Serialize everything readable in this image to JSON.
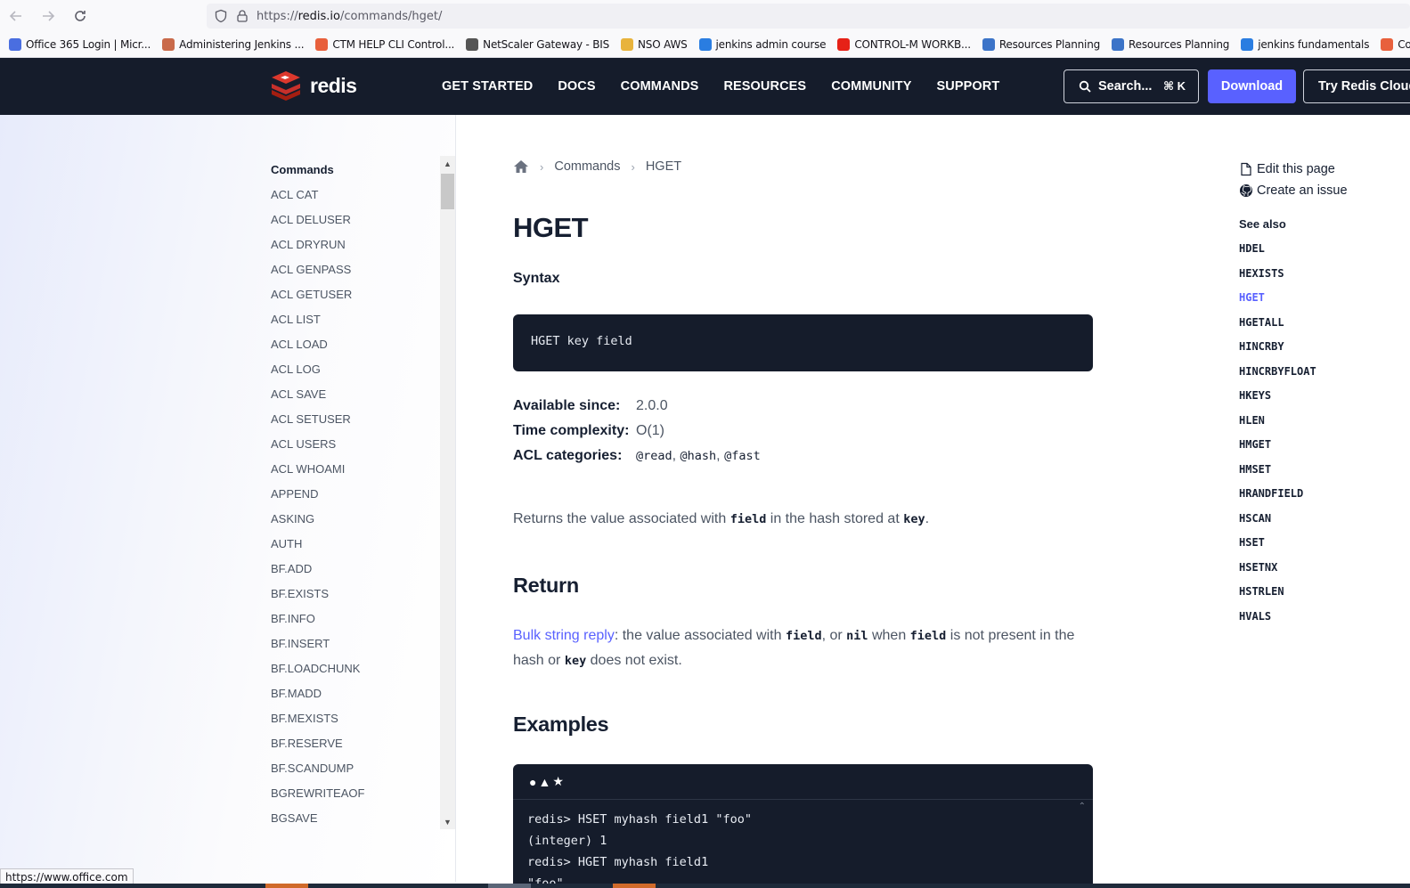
{
  "browser": {
    "url_prefix": "https://",
    "url_host": "redis.io",
    "url_path": "/commands/hget/",
    "status_url": "https://www.office.com"
  },
  "bookmarks": [
    {
      "label": "Office 365 Login | Micr...",
      "icon": "office-icon",
      "color": "#4a6ee0"
    },
    {
      "label": "Administering Jenkins ...",
      "icon": "jenkins-icon",
      "color": "#c96a4a"
    },
    {
      "label": "CTM HELP CLI Control...",
      "icon": "ctm-icon",
      "color": "#e8603c"
    },
    {
      "label": "NetScaler Gateway - BIS",
      "icon": "netscaler-icon",
      "color": "#555555"
    },
    {
      "label": "NSO AWS",
      "icon": "folder-icon",
      "color": "#e8b33c"
    },
    {
      "label": "jenkins admin course",
      "icon": "link-icon",
      "color": "#2a7de1"
    },
    {
      "label": "CONTROL-M WORKB...",
      "icon": "youtube-icon",
      "color": "#e62117"
    },
    {
      "label": "Resources Planning",
      "icon": "dbi-icon",
      "color": "#3c74c8"
    },
    {
      "label": "Resources Planning",
      "icon": "dbi-icon",
      "color": "#3c74c8"
    },
    {
      "label": "jenkins fundamentals",
      "icon": "link-icon",
      "color": "#2a7de1"
    },
    {
      "label": "Control-M/Enterpri",
      "icon": "ctm-icon",
      "color": "#e8603c"
    }
  ],
  "header": {
    "logo_text": "redis",
    "nav": [
      "GET STARTED",
      "DOCS",
      "COMMANDS",
      "RESOURCES",
      "COMMUNITY",
      "SUPPORT"
    ],
    "search_label": "Search...",
    "search_kbd": "⌘ K",
    "download_label": "Download",
    "cloud_label": "Try Redis Cloud",
    "accent": "#5961ff",
    "bg": "#151c2b"
  },
  "sidebar": {
    "heading": "Commands",
    "items": [
      "ACL CAT",
      "ACL DELUSER",
      "ACL DRYRUN",
      "ACL GENPASS",
      "ACL GETUSER",
      "ACL LIST",
      "ACL LOAD",
      "ACL LOG",
      "ACL SAVE",
      "ACL SETUSER",
      "ACL USERS",
      "ACL WHOAMI",
      "APPEND",
      "ASKING",
      "AUTH",
      "BF.ADD",
      "BF.EXISTS",
      "BF.INFO",
      "BF.INSERT",
      "BF.LOADCHUNK",
      "BF.MADD",
      "BF.MEXISTS",
      "BF.RESERVE",
      "BF.SCANDUMP",
      "BGREWRITEAOF",
      "BGSAVE"
    ]
  },
  "main": {
    "breadcrumb": [
      "Commands",
      "HGET"
    ],
    "title": "HGET",
    "syntax_heading": "Syntax",
    "syntax": "HGET key field",
    "meta": {
      "since_label": "Available since:",
      "since": "2.0.0",
      "complexity_label": "Time complexity:",
      "complexity": "O(1)",
      "acl_label": "ACL categories:",
      "acl": [
        "@read",
        "@hash",
        "@fast"
      ]
    },
    "description": {
      "before": "Returns the value associated with ",
      "code1": "field",
      "middle": " in the hash stored at ",
      "code2": "key",
      "after": "."
    },
    "return_heading": "Return",
    "return": {
      "link": "Bulk string reply",
      "t1": ": the value associated with ",
      "c1": "field",
      "t2": ", or ",
      "c2": "nil",
      "t3": " when ",
      "c3": "field",
      "t4": " is not present in the hash or ",
      "c4": "key",
      "t5": " does not exist."
    },
    "examples_heading": "Examples",
    "example_lines": [
      "redis> HSET myhash field1 \"foo\"",
      "(integer) 1",
      "redis> HGET myhash field1",
      "\"foo\""
    ]
  },
  "right": {
    "edit_label": "Edit this page",
    "issue_label": "Create an issue",
    "see_also": "See also",
    "related": [
      "HDEL",
      "HEXISTS",
      "HGET",
      "HGETALL",
      "HINCRBY",
      "HINCRBYFLOAT",
      "HKEYS",
      "HLEN",
      "HMGET",
      "HMSET",
      "HRANDFIELD",
      "HSCAN",
      "HSET",
      "HSETNX",
      "HSTRLEN",
      "HVALS"
    ],
    "active": "HGET"
  }
}
